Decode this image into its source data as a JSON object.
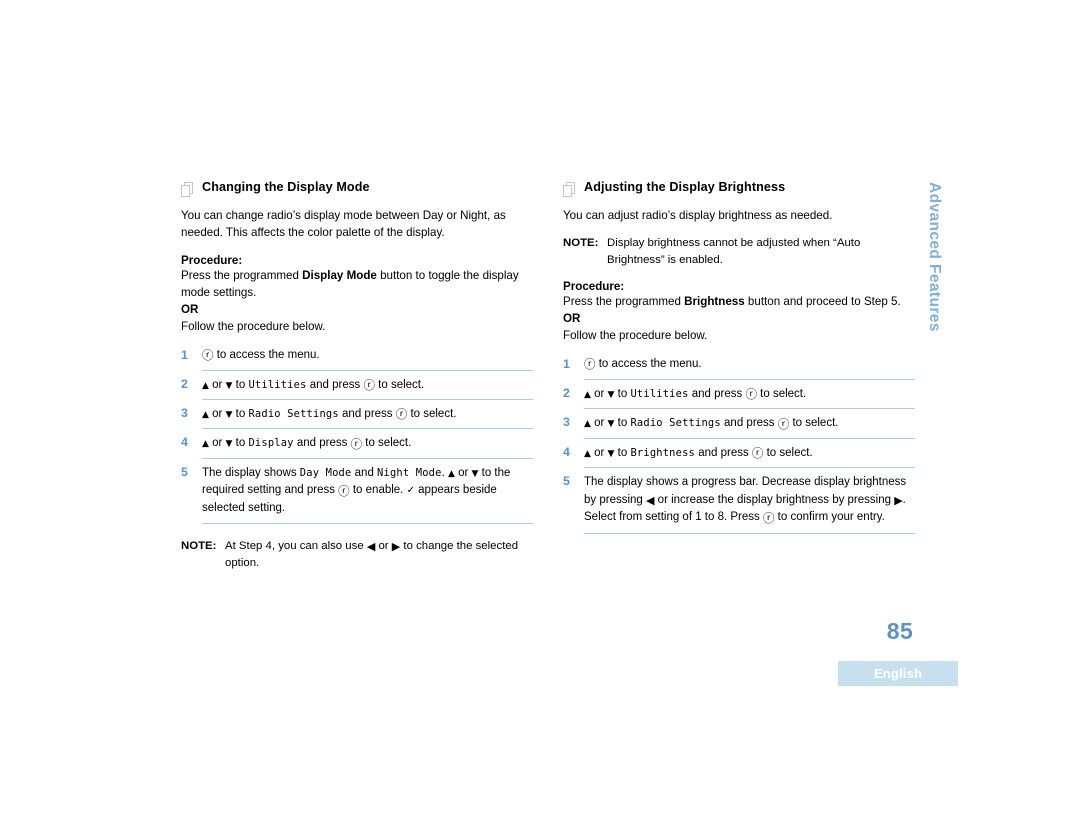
{
  "page": {
    "number": "85",
    "language_badge": "English",
    "side_tab": "Advanced Features"
  },
  "glyphs": {
    "menu": "ⓡ",
    "up": "▲",
    "down": "▼",
    "left": "◀",
    "right": "▶",
    "check": "✓"
  },
  "left_section": {
    "heading": "Changing the Display Mode",
    "intro": "You can change radio’s display mode between Day or Night, as needed. This affects the color palette of the display.",
    "procedure_label": "Procedure:",
    "procedure_lead_pre": "Press the programmed ",
    "procedure_lead_bold": "Display Mode",
    "procedure_lead_post": " button to toggle the display mode settings.",
    "or_label": "OR",
    "follow": "Follow the procedure below.",
    "steps": [
      {
        "num": "1",
        "parts": [
          {
            "type": "glyph",
            "name": "menu"
          },
          {
            "type": "text",
            "value": " to access the menu."
          }
        ]
      },
      {
        "num": "2",
        "parts": [
          {
            "type": "glyph",
            "name": "up"
          },
          {
            "type": "text",
            "value": " or "
          },
          {
            "type": "glyph",
            "name": "down"
          },
          {
            "type": "text",
            "value": " to "
          },
          {
            "type": "mono",
            "value": "Utilities"
          },
          {
            "type": "text",
            "value": " and press "
          },
          {
            "type": "glyph",
            "name": "menu"
          },
          {
            "type": "text",
            "value": " to select."
          }
        ]
      },
      {
        "num": "3",
        "parts": [
          {
            "type": "glyph",
            "name": "up"
          },
          {
            "type": "text",
            "value": " or "
          },
          {
            "type": "glyph",
            "name": "down"
          },
          {
            "type": "text",
            "value": " to "
          },
          {
            "type": "mono",
            "value": "Radio Settings"
          },
          {
            "type": "text",
            "value": " and press "
          },
          {
            "type": "glyph",
            "name": "menu"
          },
          {
            "type": "text",
            "value": " to select."
          }
        ]
      },
      {
        "num": "4",
        "parts": [
          {
            "type": "glyph",
            "name": "up"
          },
          {
            "type": "text",
            "value": " or "
          },
          {
            "type": "glyph",
            "name": "down"
          },
          {
            "type": "text",
            "value": " to "
          },
          {
            "type": "mono",
            "value": "Display"
          },
          {
            "type": "text",
            "value": " and press "
          },
          {
            "type": "glyph",
            "name": "menu"
          },
          {
            "type": "text",
            "value": " to select."
          }
        ]
      },
      {
        "num": "5",
        "parts": [
          {
            "type": "text",
            "value": "The display shows "
          },
          {
            "type": "mono",
            "value": "Day Mode"
          },
          {
            "type": "text",
            "value": " and "
          },
          {
            "type": "mono",
            "value": "Night Mode"
          },
          {
            "type": "text",
            "value": ". "
          },
          {
            "type": "glyph",
            "name": "up"
          },
          {
            "type": "text",
            "value": " or "
          },
          {
            "type": "glyph",
            "name": "down"
          },
          {
            "type": "text",
            "value": " to the required setting and press "
          },
          {
            "type": "glyph",
            "name": "menu"
          },
          {
            "type": "text",
            "value": " to enable. "
          },
          {
            "type": "glyph",
            "name": "check"
          },
          {
            "type": "text",
            "value": " appears beside selected setting."
          }
        ]
      }
    ],
    "note": {
      "label": "NOTE:",
      "parts": [
        {
          "type": "text",
          "value": "At Step 4, you can also use "
        },
        {
          "type": "glyph",
          "name": "left"
        },
        {
          "type": "text",
          "value": " or "
        },
        {
          "type": "glyph",
          "name": "right"
        },
        {
          "type": "text",
          "value": " to change the selected option."
        }
      ]
    }
  },
  "right_section": {
    "heading": "Adjusting the Display Brightness",
    "intro": "You can adjust radio’s display brightness as needed.",
    "note": {
      "label": "NOTE:",
      "parts": [
        {
          "type": "text",
          "value": "Display brightness cannot be adjusted when “Auto Brightness” is enabled."
        }
      ]
    },
    "procedure_label": "Procedure:",
    "procedure_lead_pre": "Press the programmed ",
    "procedure_lead_bold": "Brightness",
    "procedure_lead_post": " button and proceed to Step 5.",
    "or_label": "OR",
    "follow": "Follow the procedure below.",
    "steps": [
      {
        "num": "1",
        "parts": [
          {
            "type": "glyph",
            "name": "menu"
          },
          {
            "type": "text",
            "value": " to access the menu."
          }
        ]
      },
      {
        "num": "2",
        "parts": [
          {
            "type": "glyph",
            "name": "up"
          },
          {
            "type": "text",
            "value": " or "
          },
          {
            "type": "glyph",
            "name": "down"
          },
          {
            "type": "text",
            "value": " to "
          },
          {
            "type": "mono",
            "value": "Utilities"
          },
          {
            "type": "text",
            "value": " and press "
          },
          {
            "type": "glyph",
            "name": "menu"
          },
          {
            "type": "text",
            "value": " to select."
          }
        ]
      },
      {
        "num": "3",
        "parts": [
          {
            "type": "glyph",
            "name": "up"
          },
          {
            "type": "text",
            "value": " or "
          },
          {
            "type": "glyph",
            "name": "down"
          },
          {
            "type": "text",
            "value": " to "
          },
          {
            "type": "mono",
            "value": "Radio Settings"
          },
          {
            "type": "text",
            "value": " and press "
          },
          {
            "type": "glyph",
            "name": "menu"
          },
          {
            "type": "text",
            "value": " to select."
          }
        ]
      },
      {
        "num": "4",
        "parts": [
          {
            "type": "glyph",
            "name": "up"
          },
          {
            "type": "text",
            "value": " or "
          },
          {
            "type": "glyph",
            "name": "down"
          },
          {
            "type": "text",
            "value": " to "
          },
          {
            "type": "mono",
            "value": "Brightness"
          },
          {
            "type": "text",
            "value": " and press "
          },
          {
            "type": "glyph",
            "name": "menu"
          },
          {
            "type": "text",
            "value": " to select."
          }
        ]
      },
      {
        "num": "5",
        "parts": [
          {
            "type": "text",
            "value": "The display shows a progress bar. Decrease display brightness by pressing "
          },
          {
            "type": "glyph",
            "name": "left"
          },
          {
            "type": "text",
            "value": " or increase the display brightness by pressing "
          },
          {
            "type": "glyph",
            "name": "right"
          },
          {
            "type": "text",
            "value": ". Select from setting of 1 to 8. Press "
          },
          {
            "type": "glyph",
            "name": "menu"
          },
          {
            "type": "text",
            "value": " to confirm your entry."
          }
        ]
      }
    ]
  },
  "colors": {
    "accent_blue": "#5b93c4",
    "rule_blue": "#aecde3",
    "tab_blue": "#7fb0d6",
    "badge_blue": "#c6e0ee",
    "icon_gray": "#c3c6c9"
  }
}
